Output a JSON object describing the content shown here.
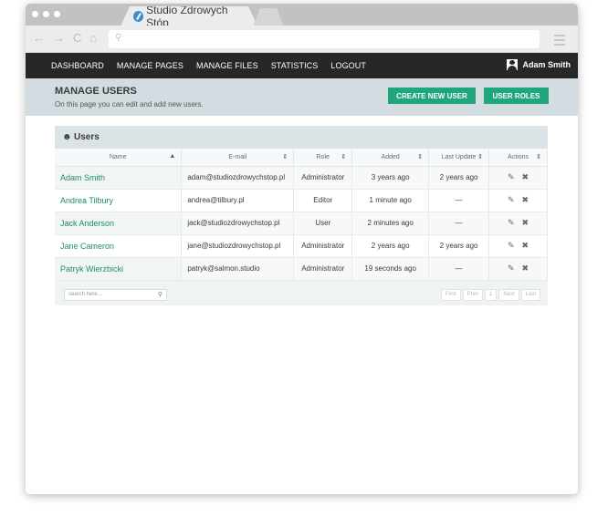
{
  "browser": {
    "tab_title": "Studio Zdrowych Stóp",
    "tab_close": "×",
    "nav_icons": [
      "←",
      "→",
      "C",
      "⌂"
    ],
    "url_search_icon": "search-icon"
  },
  "nav": {
    "links": [
      "DASHBOARD",
      "MANAGE PAGES",
      "MANAGE FILES",
      "STATISTICS",
      "LOGOUT"
    ],
    "user_name": "Adam Smith"
  },
  "page": {
    "title": "MANAGE USERS",
    "subtitle": "On this page you can edit and add new users.",
    "create_button": "CREATE NEW USER",
    "roles_button": "USER ROLES"
  },
  "panel": {
    "title": "Users"
  },
  "table": {
    "headers": [
      "Name",
      "E-mail",
      "Role",
      "Added",
      "Last Update",
      "Actions"
    ],
    "rows": [
      {
        "name": "Adam Smith",
        "email": "adam@studiozdrowychstop.pl",
        "role": "Administrator",
        "added": "3 years ago",
        "updated": "2 years ago"
      },
      {
        "name": "Andrea Tilbury",
        "email": "andrea@tilbury.pl",
        "role": "Editor",
        "added": "1 minute ago",
        "updated": "—"
      },
      {
        "name": "Jack Anderson",
        "email": "jack@studiozdrowychstop.pl",
        "role": "User",
        "added": "2 minutes ago",
        "updated": "—"
      },
      {
        "name": "Jane Cameron",
        "email": "jane@studiozdrowychstop.pl",
        "role": "Administrator",
        "added": "2 years ago",
        "updated": "2 years ago"
      },
      {
        "name": "Patryk Wierzbicki",
        "email": "patryk@salmon.studio",
        "role": "Administrator",
        "added": "19 seconds ago",
        "updated": "—"
      }
    ]
  },
  "footer": {
    "search_placeholder": "search here...",
    "pager": [
      "First",
      "Prev",
      "1",
      "Next",
      "Last"
    ]
  },
  "colors": {
    "accent": "#20a67c",
    "nav_bg": "#272727",
    "header_bg": "#d3dce1"
  }
}
